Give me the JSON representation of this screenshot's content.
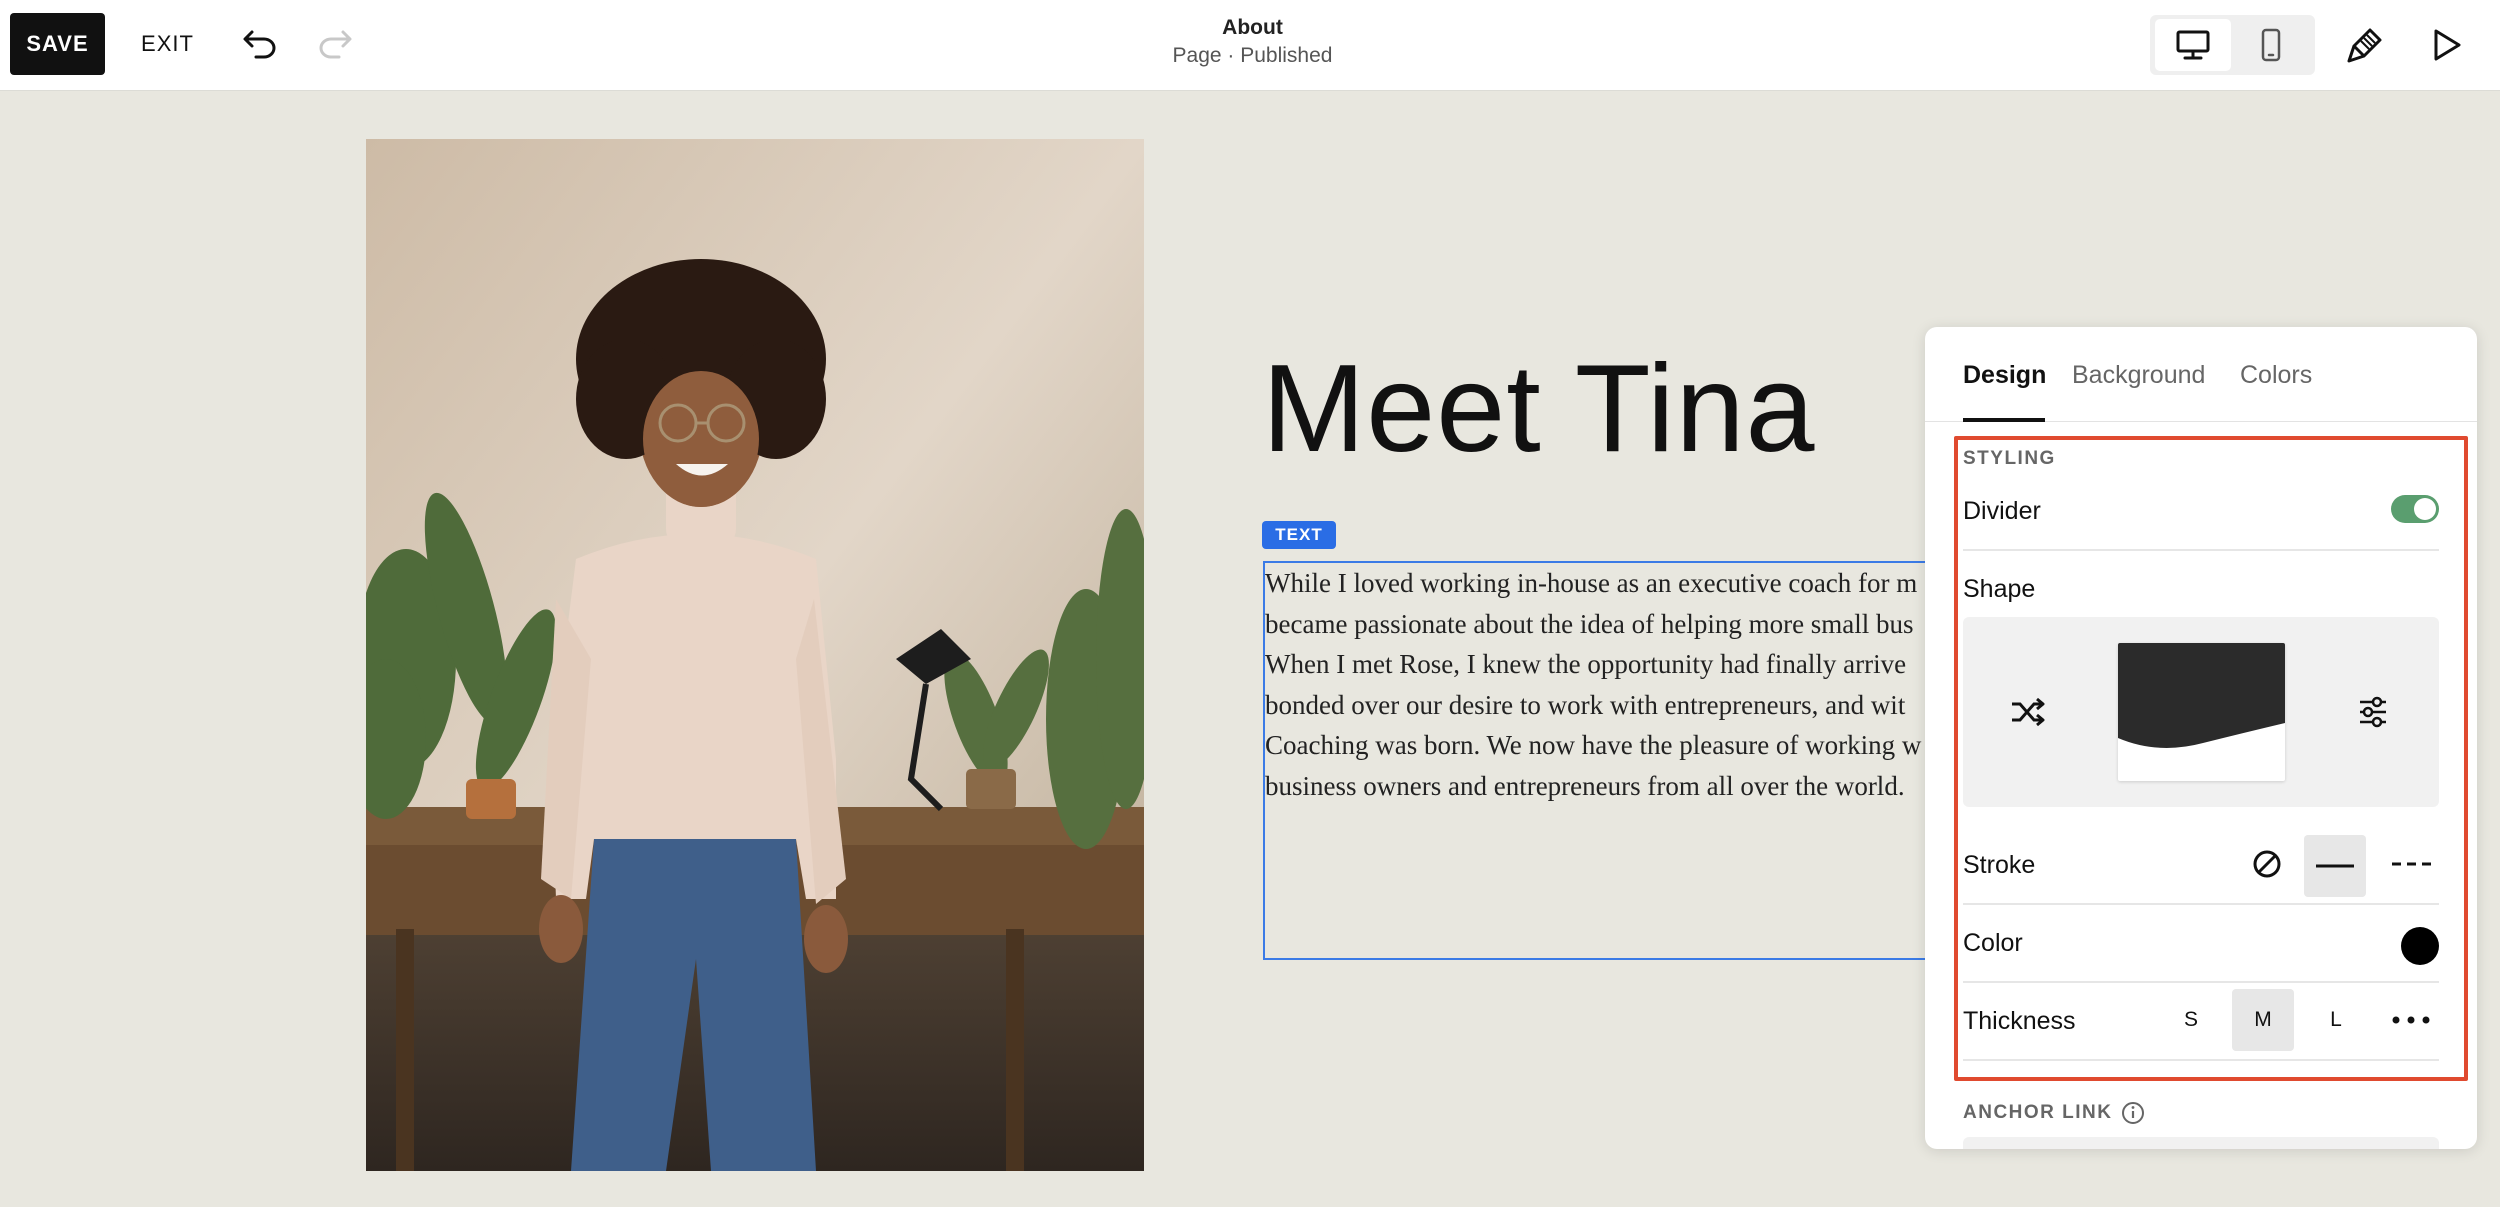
{
  "toolbar": {
    "save_label": "SAVE",
    "exit_label": "EXIT",
    "page_title": "About",
    "page_status": "Page · Published",
    "view_mode": "desktop"
  },
  "canvas": {
    "heading": "Meet Tina",
    "badge": "TEXT",
    "paragraph_lines": [
      "While I loved working in-house as an executive coach for m",
      "became passionate about the idea of helping more small bus",
      "When I met Rose, I knew the opportunity had finally arrive",
      "bonded over our desire to work with entrepreneurs, and wit",
      "Coaching was born. We now have the pleasure of working w",
      "business owners and entrepreneurs from all over the world."
    ]
  },
  "panel": {
    "tabs": [
      "Design",
      "Background",
      "Colors"
    ],
    "active_tab": "Design",
    "styling_label": "STYLING",
    "divider_label": "Divider",
    "divider_on": true,
    "shape_label": "Shape",
    "stroke_label": "Stroke",
    "stroke_selected": "solid",
    "color_label": "Color",
    "color_value": "#000000",
    "thickness_label": "Thickness",
    "thickness_options": [
      "S",
      "M",
      "L"
    ],
    "thickness_selected": "M",
    "anchor_label": "ANCHOR LINK"
  },
  "colors": {
    "toggle_on": "#5a9e6f",
    "highlight": "#e04a2f",
    "selection": "#2a6de5"
  }
}
